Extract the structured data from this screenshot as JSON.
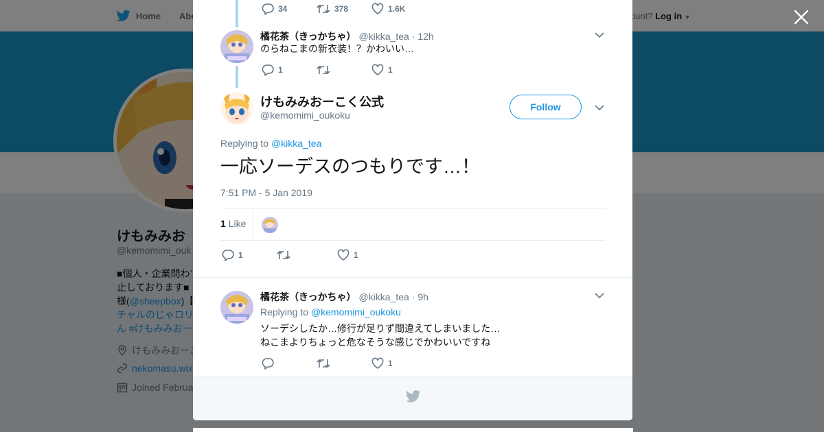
{
  "background": {
    "nav": {
      "home_label": "Home",
      "about_label": "Abo",
      "account_prompt": "ccount?",
      "login_label": "Log in"
    },
    "profile": {
      "name": "けもみみお",
      "handle": "@kemomimi_ouk",
      "bio_lines": [
        "■個人・企業問わず",
        "止しております■",
        "様(",
        "@sheepbox",
        ")【",
        "チャルのじゃロリ",
        "ん #けもみみおー"
      ],
      "location": "けもみみおーこ",
      "website": "nekomasu.wix",
      "joined": "Joined Februa"
    }
  },
  "modal": {
    "tweet1_actions": {
      "replies": "34",
      "retweets": "378",
      "likes": "1.6K"
    },
    "tweet2": {
      "name": "橘花茶（きっかちゃ）",
      "handle": "@kikka_tea",
      "time": "· 12h",
      "text": "のらねこまの新衣装！？かわいい…",
      "replies": "1",
      "likes": "1"
    },
    "main": {
      "name": "けもみみおーこく公式",
      "handle": "@kemomimi_oukoku",
      "follow_label": "Follow",
      "replying_prefix": "Replying to",
      "replying_to": "@kikka_tea",
      "text": "一応ソーデスのつもりです…！",
      "timestamp": "7:51 PM - 5 Jan 2019",
      "like_count": "1",
      "like_label": "Like",
      "replies": "1",
      "likes": "1"
    },
    "tweet3": {
      "name": "橘花茶（きっかちゃ）",
      "handle": "@kikka_tea",
      "time": "· 9h",
      "replying_prefix": "Replying to",
      "replying_to": "@kemomimi_oukoku",
      "text_line1": "ソーデシしたか…修行が足りず間違えてしまいました…",
      "text_line2": "ねこまよりちょっと危なそうな感じでかわいいですね",
      "likes": "1"
    }
  },
  "colors": {
    "accent": "#1b95e0",
    "banner": "#1b95c9",
    "thread_line": "#a6d5f0",
    "muted": "#657786"
  }
}
